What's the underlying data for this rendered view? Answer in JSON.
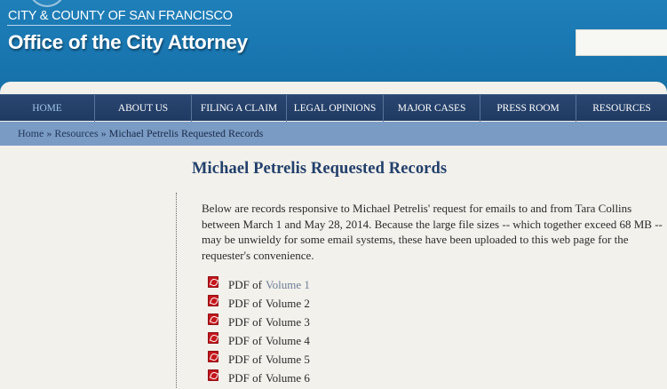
{
  "header": {
    "city_line": "CITY & COUNTY OF SAN FRANCISCO",
    "office_title": "Office of the City Attorney"
  },
  "nav": {
    "items": [
      {
        "label": "HOME"
      },
      {
        "label": "ABOUT US"
      },
      {
        "label": "FILING A CLAIM"
      },
      {
        "label": "LEGAL OPINIONS"
      },
      {
        "label": "MAJOR CASES"
      },
      {
        "label": "PRESS ROOM"
      },
      {
        "label": "RESOURCES"
      }
    ]
  },
  "breadcrumb": {
    "home": "Home",
    "sep1": "»",
    "resources": "Resources",
    "sep2": "»",
    "current": "Michael Petrelis Requested Records"
  },
  "main": {
    "title": "Michael Petrelis Requested Records",
    "intro": "Below are records responsive to Michael Petrelis' request for emails to and from Tara Collins between March 1 and May 28, 2014. Because the large file sizes -- which together exceed 68 MB -- may be unwieldy for some email systems, these have been uploaded to this web page for the requester's convenience.",
    "pdf_prefix": "PDF of",
    "volumes": [
      {
        "label": "Volume 1"
      },
      {
        "label": "Volume 2"
      },
      {
        "label": "Volume 3"
      },
      {
        "label": "Volume 4"
      },
      {
        "label": "Volume 5"
      },
      {
        "label": "Volume 6"
      }
    ]
  },
  "colors": {
    "header_blue": "#1a78b2",
    "nav_navy": "#1f3a62",
    "breadcrumb_blue": "#7a9bc4",
    "title_blue": "#22406b",
    "pdf_red": "#c4171c"
  },
  "icons": {
    "pdf": "pdf-file-icon",
    "seal": "city-seal-icon"
  }
}
